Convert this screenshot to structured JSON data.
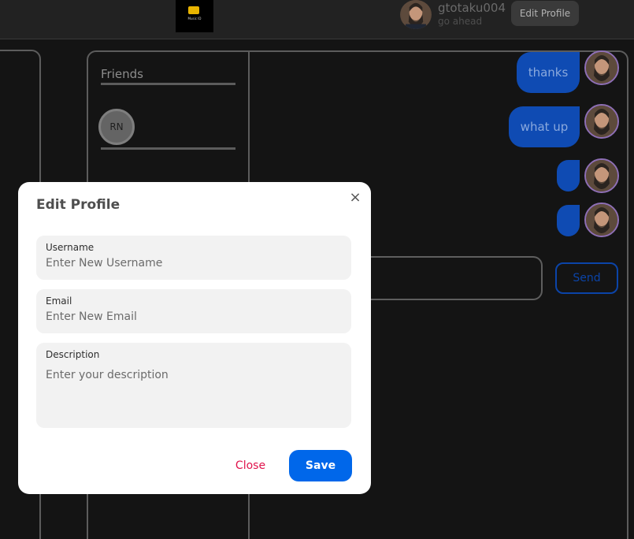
{
  "header": {
    "logo_text": "Music ID",
    "username": "gtotaku004",
    "status": "go ahead",
    "edit_profile_label": "Edit Profile"
  },
  "sidebar": {
    "friends_title": "Friends",
    "friends": [
      {
        "initials": "RN"
      }
    ]
  },
  "chat": {
    "messages": [
      {
        "text": "thanks"
      },
      {
        "text": "what up"
      },
      {
        "text": ""
      },
      {
        "text": ""
      }
    ],
    "send_label": "Send"
  },
  "modal": {
    "title": "Edit Profile",
    "close_icon": "×",
    "fields": {
      "username": {
        "label": "Username",
        "placeholder": "Enter New Username",
        "value": ""
      },
      "email": {
        "label": "Email",
        "placeholder": "Enter New Email",
        "value": ""
      },
      "description": {
        "label": "Description",
        "placeholder": "Enter your description",
        "value": ""
      }
    },
    "close_label": "Close",
    "save_label": "Save"
  },
  "colors": {
    "accent": "#0067ea",
    "bubble": "#0f4bb3",
    "danger": "#e0134c",
    "background": "#141414"
  },
  "icons": [
    "close-icon",
    "app-logo",
    "avatar-photo"
  ]
}
